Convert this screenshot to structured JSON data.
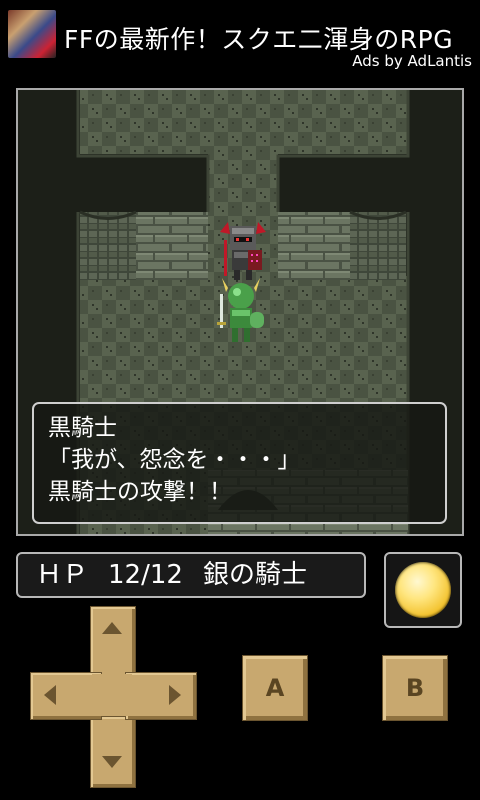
{
  "ad": {
    "title": "FFの最新作！スクエ二渾身のRPG",
    "credit": "Ads by AdLantis"
  },
  "dialogue": {
    "speaker": "黒騎士",
    "line1": "「我が、怨念を・・・」",
    "line2": "黒騎士の攻撃！！"
  },
  "status": {
    "hp_label": "ＨＰ",
    "hp_value": "12/12",
    "name": "銀の騎士"
  },
  "controls": {
    "a_label": "A",
    "b_label": "B"
  },
  "colors": {
    "button_tan": "#c8a86f",
    "floor_tile": "#505a46",
    "wall_dark": "#1c1f18",
    "orb_gold": "#f3c330"
  }
}
